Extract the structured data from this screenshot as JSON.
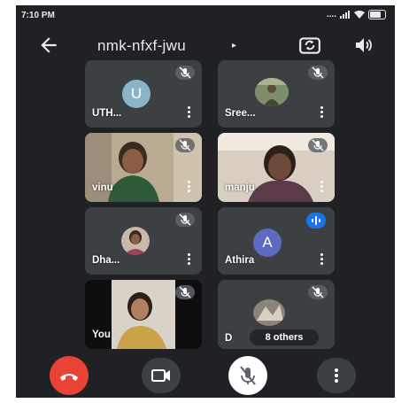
{
  "status_bar": {
    "time": "7:10 PM",
    "network": "....",
    "signal": "ıl"
  },
  "header": {
    "meeting_code": "nmk-nfxf-jwu",
    "caret": "▸"
  },
  "participants": [
    {
      "name": "UTH...",
      "avatar_letter": "U",
      "avatar_color": "#8ab4c8",
      "muted": true
    },
    {
      "name": "Sree...",
      "muted": true
    },
    {
      "name": "vinu",
      "muted": true
    },
    {
      "name": "manju",
      "muted": true
    },
    {
      "name": "Dha...",
      "muted": true
    },
    {
      "name": "Athira",
      "avatar_letter": "A",
      "avatar_color": "#5c6bc0",
      "speaking": true
    },
    {
      "name": "You",
      "muted": true
    },
    {
      "name": "D",
      "others_label": "8 others",
      "muted": true
    }
  ],
  "controls": {
    "end_call_color": "#ea4335",
    "mic_button_color": "#ffffff",
    "dark_button_color": "#3c4043"
  }
}
